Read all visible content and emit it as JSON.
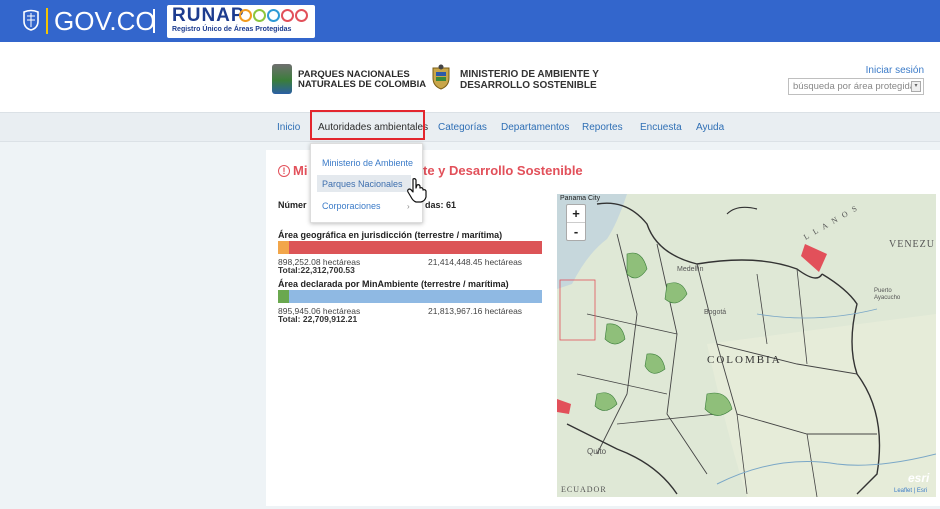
{
  "govbar": {
    "gov_text": "GOV.CO",
    "runap_title": "RUNAP",
    "runap_subtitle": "Registro Único de Áreas Protegidas",
    "runap_dot_colors": [
      "#f29b1e",
      "#8cc63f",
      "#2e9ad6",
      "#e2505a",
      "#e2505a"
    ]
  },
  "header": {
    "pnn_line1": "PARQUES NACIONALES",
    "pnn_line2": "NATURALES DE COLOMBIA",
    "min_line1": "MINISTERIO DE AMBIENTE Y",
    "min_line2": "DESARROLLO SOSTENIBLE",
    "login_link": "Iniciar sesión",
    "search_placeholder": "búsqueda por área protegida"
  },
  "nav": {
    "items": [
      "Inicio",
      "Autoridades ambientales",
      "Categorías",
      "Departamentos",
      "Reportes",
      "Encuesta",
      "Ayuda"
    ],
    "active_index": 1
  },
  "dropdown": {
    "items": [
      "Ministerio de Ambiente",
      "Parques Nacionales",
      "Corporaciones"
    ],
    "hovered_index": 1,
    "submenu_arrow": "›"
  },
  "content": {
    "heading_prefix": "Mi",
    "heading_suffix": "te y Desarrollo Sostenible",
    "count_label": "Númer",
    "count_suffix": "das: 61",
    "section1": {
      "title": "Área geográfica en jurisdicción (terrestre / marítima)",
      "left_value": "898,252.08 hectáreas",
      "right_value": "21,414,448.45 hectáreas",
      "total": "Total:22,312,700.53",
      "left_share": 0.04,
      "colors": [
        "#f2a64a",
        "#dc5457"
      ]
    },
    "section2": {
      "title": "Área declarada por MinAmbiente (terrestre / marítima)",
      "left_value": "895,945.06 hectáreas",
      "right_value": "21,813,967.16 hectáreas",
      "total": "Total: 22,709,912.21",
      "left_share": 0.04,
      "colors": [
        "#6aa84f",
        "#8fb9e3"
      ]
    }
  },
  "map": {
    "labels": {
      "panama": "Panama City",
      "venezuela": "VENEZU",
      "colombia": "COLOMBIA",
      "quito": "Quito",
      "ecuador": "ECUADOR",
      "medellin": "Medellín",
      "bogota": "Bogotá",
      "puerto": "Puerto Ayacucho",
      "sea": "L L A N O S"
    },
    "zoom_in": "+",
    "zoom_out": "-",
    "attribution": "Leaflet | Esri",
    "logo": "esri"
  }
}
